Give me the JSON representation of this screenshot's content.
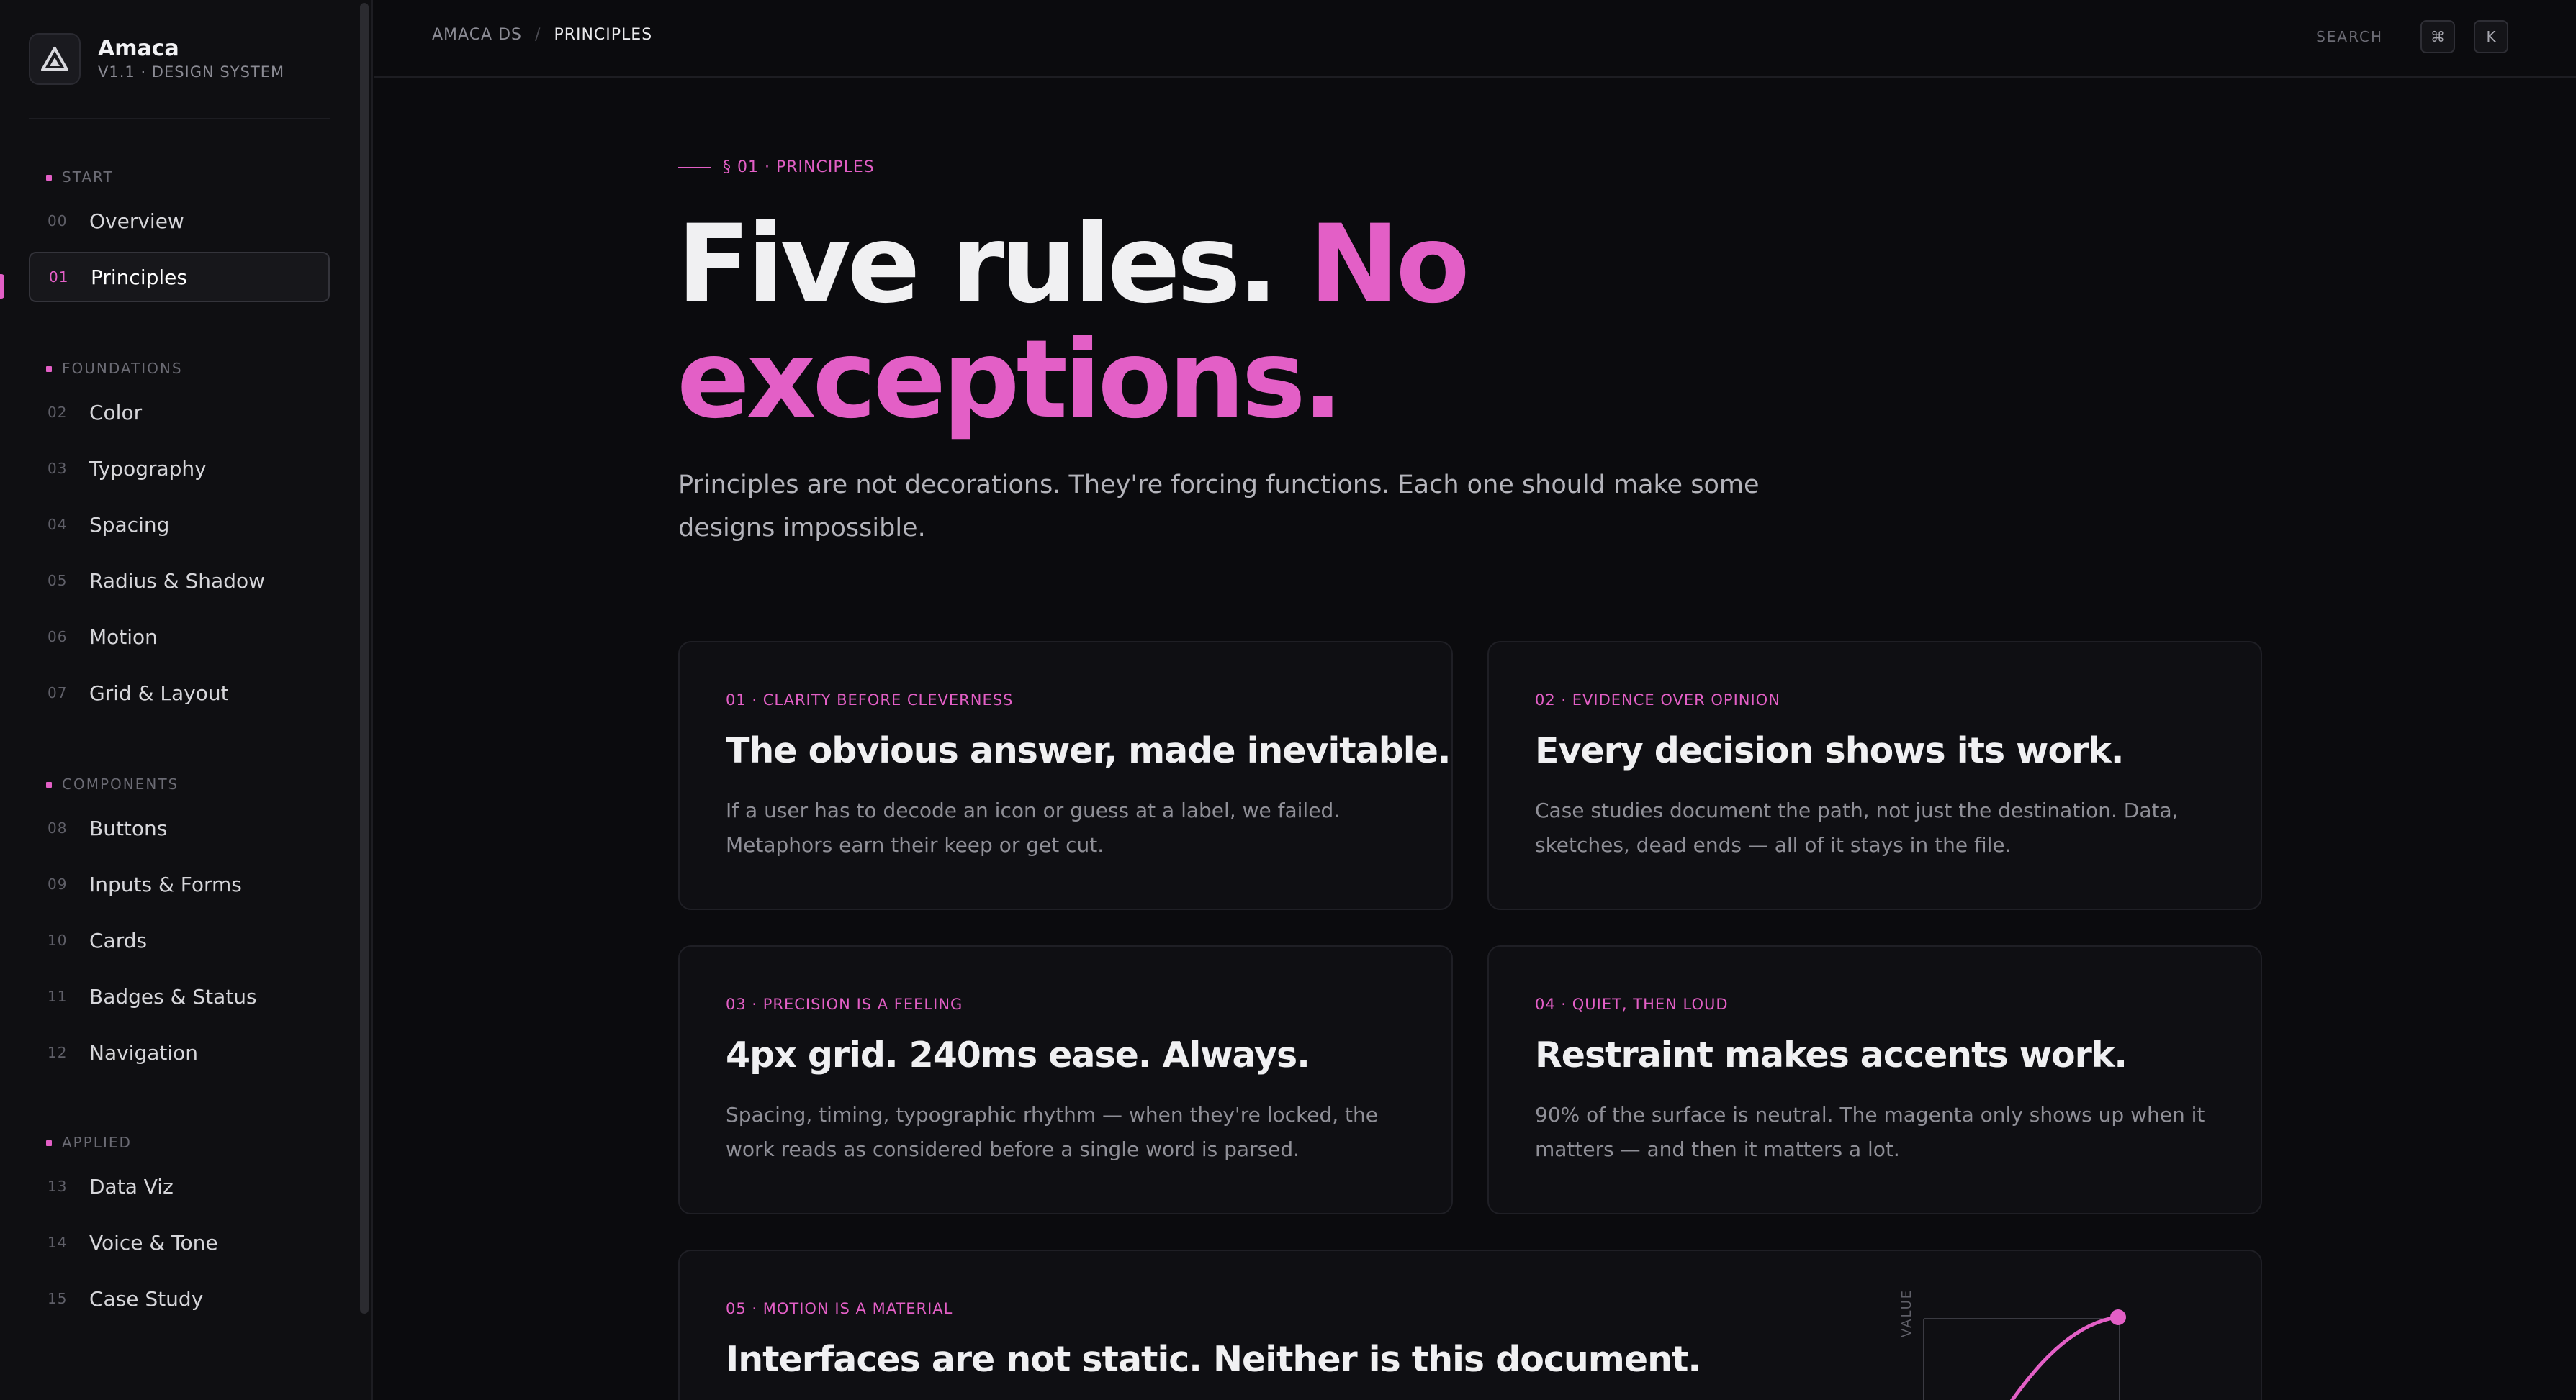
{
  "brand": {
    "name": "Amaca",
    "subtitle": "V1.1 · DESIGN SYSTEM"
  },
  "sidebar": {
    "groups": [
      {
        "heading": "START",
        "items": [
          {
            "num": "00",
            "label": "Overview"
          },
          {
            "num": "01",
            "label": "Principles",
            "active": true
          }
        ]
      },
      {
        "heading": "FOUNDATIONS",
        "items": [
          {
            "num": "02",
            "label": "Color"
          },
          {
            "num": "03",
            "label": "Typography"
          },
          {
            "num": "04",
            "label": "Spacing"
          },
          {
            "num": "05",
            "label": "Radius & Shadow"
          },
          {
            "num": "06",
            "label": "Motion"
          },
          {
            "num": "07",
            "label": "Grid & Layout"
          }
        ]
      },
      {
        "heading": "COMPONENTS",
        "items": [
          {
            "num": "08",
            "label": "Buttons"
          },
          {
            "num": "09",
            "label": "Inputs & Forms"
          },
          {
            "num": "10",
            "label": "Cards"
          },
          {
            "num": "11",
            "label": "Badges & Status"
          },
          {
            "num": "12",
            "label": "Navigation"
          }
        ]
      },
      {
        "heading": "APPLIED",
        "items": [
          {
            "num": "13",
            "label": "Data Viz"
          },
          {
            "num": "14",
            "label": "Voice & Tone"
          },
          {
            "num": "15",
            "label": "Case Study"
          }
        ]
      }
    ]
  },
  "topbar": {
    "breadcrumb": [
      "AMACA DS",
      "PRINCIPLES"
    ],
    "search_label": "SEARCH",
    "shortcut_keys": [
      "⌘",
      "K"
    ]
  },
  "hero": {
    "eyebrow": "§ 01 · PRINCIPLES",
    "title_plain": "Five rules.",
    "title_accent": "No exceptions.",
    "lede": "Principles are not decorations. They're forcing functions. Each one should make some designs impossible."
  },
  "principles": [
    {
      "kicker": "01 · CLARITY BEFORE CLEVERNESS",
      "title": "The obvious answer, made inevitable.",
      "body": "If a user has to decode an icon or guess at a label, we failed. Metaphors earn their keep or get cut."
    },
    {
      "kicker": "02 · EVIDENCE OVER OPINION",
      "title": "Every decision shows its work.",
      "body": "Case studies document the path, not just the destination. Data, sketches, dead ends — all of it stays in the file."
    },
    {
      "kicker": "03 · PRECISION IS A FEELING",
      "title": "4px grid. 240ms ease. Always.",
      "body": "Spacing, timing, typographic rhythm — when they're locked, the work reads as considered before a single word is parsed."
    },
    {
      "kicker": "04 · QUIET, THEN LOUD",
      "title": "Restraint makes accents work.",
      "body": "90% of the surface is neutral. The magenta only shows up when it matters — and then it matters a lot."
    },
    {
      "kicker": "05 · MOTION IS A MATERIAL",
      "title": "Interfaces are not static. Neither is this document.",
      "body": ""
    }
  ],
  "motion_chart": {
    "ylabel": "VALUE"
  },
  "colors": {
    "accent": "#e35fc6",
    "background": "#0b0b0e",
    "surface": "#0f0f13"
  }
}
